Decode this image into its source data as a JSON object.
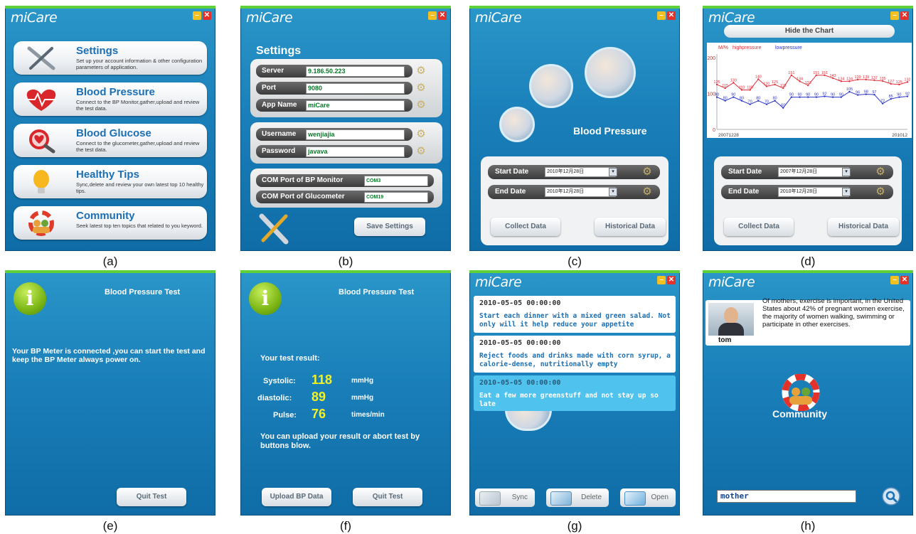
{
  "app_name": "miCare",
  "window_controls": {
    "minimize": "–",
    "close": "✕"
  },
  "captions": [
    "(a)",
    "(b)",
    "(c)",
    "(d)",
    "(e)",
    "(f)",
    "(g)",
    "(h)"
  ],
  "panel_a": {
    "menu": [
      {
        "title": "Settings",
        "desc": "Set up your account information & other configuration parameters of application.",
        "icon": "wrench-screwdriver-icon"
      },
      {
        "title": "Blood Pressure",
        "desc": "Connect to the BP Monitor,gather,upload and review the test data.",
        "icon": "heart-pulse-icon"
      },
      {
        "title": "Blood Glucose",
        "desc": "Connect to the glucometer,gather,upload and review the test data.",
        "icon": "magnifier-heart-icon"
      },
      {
        "title": "Healthy Tips",
        "desc": "Sync,delete and review your own latest top 10 healthy tips.",
        "icon": "light-bulb-icon"
      },
      {
        "title": "Community",
        "desc": "Seek latest top ten topics that related to you keyword.",
        "icon": "lifebuoy-people-icon"
      }
    ]
  },
  "panel_b": {
    "title": "Settings",
    "server": {
      "label": "Server",
      "value": "9.186.50.223"
    },
    "port": {
      "label": "Port",
      "value": "9080"
    },
    "app_name": {
      "label": "App Name",
      "value": "miCare"
    },
    "username": {
      "label": "Username",
      "value": "wenjiajia"
    },
    "password": {
      "label": "Password",
      "value": "javava"
    },
    "com_bp": {
      "label": "COM Port of BP  Monitor",
      "value": "COM3"
    },
    "com_glucometer": {
      "label": "COM Port of Glucometer",
      "value": "COM19"
    },
    "save_button": "Save Settings"
  },
  "panel_c": {
    "title": "Blood Pressure",
    "start_date": {
      "label": "Start Date",
      "value": "2010年12月28日"
    },
    "end_date": {
      "label": "End Date",
      "value": "2010年12月28日"
    },
    "collect_button": "Collect Data",
    "historical_button": "Historical Data"
  },
  "panel_d": {
    "hide_button": "Hide the Chart",
    "start_date": {
      "label": "Start Date",
      "value": "2007年12月28日"
    },
    "end_date": {
      "label": "End Date",
      "value": "2010年12月28日"
    },
    "collect_button": "Collect Data",
    "historical_button": "Historical Data",
    "chart_data": {
      "type": "line",
      "legend_title": "M/%",
      "series": [
        {
          "name": "highpressure",
          "color": "#e0303a",
          "values": [
            125,
            115,
            130,
            110,
            110,
            140,
            120,
            125,
            115,
            151,
            134,
            123,
            151,
            151,
            143,
            134,
            134,
            139,
            139,
            137,
            135,
            127,
            125,
            132
          ]
        },
        {
          "name": "lowpressure",
          "color": "#2c35c8",
          "values": [
            90,
            80,
            90,
            80,
            70,
            80,
            70,
            80,
            60,
            90,
            90,
            90,
            90,
            92,
            90,
            90,
            105,
            96,
            98,
            97,
            72,
            85,
            90,
            92
          ]
        }
      ],
      "y_ticks": [
        "0",
        "100",
        "200"
      ],
      "ylim": [
        0,
        210
      ],
      "x_start_label": "20071228",
      "x_end_label": "201012"
    }
  },
  "panel_e": {
    "title": "Blood Pressure Test",
    "message": "Your BP Meter is connected ,you can start the test and keep the BP Meter always power on.",
    "quit_button": "Quit Test"
  },
  "panel_f": {
    "title": "Blood Pressure Test",
    "result_heading": "Your test result:",
    "systolic": {
      "label": "Systolic:",
      "value": "118",
      "unit": "mmHg"
    },
    "diastolic": {
      "label": "diastolic:",
      "value": "89",
      "unit": "mmHg"
    },
    "pulse": {
      "label": "Pulse:",
      "value": "76",
      "unit": "times/min"
    },
    "note": "You can upload your result or abort test by buttons blow.",
    "upload_button": "Upload BP Data",
    "quit_button": "Quit Test"
  },
  "panel_g": {
    "tips": [
      {
        "time": "2010-05-05 00:00:00",
        "text": "Start each dinner with a mixed green salad. Not only will it help reduce your appetite"
      },
      {
        "time": "2010-05-05 00:00:00",
        "text": "Reject foods and drinks made with corn syrup, a calorie-dense, nutritionally empty"
      },
      {
        "time": "2010-05-05 00:00:00",
        "text": "Eat a few more greenstuff and not stay up so late"
      }
    ],
    "sync_button": "Sync",
    "delete_button": "Delete",
    "open_button": "Open"
  },
  "panel_h": {
    "user_name": "tom",
    "post": "Of mothers, exercise is important, in the United States about 42% of pregnant women exercise, the majority of women walking, swimming or participate in other exercises.",
    "title": "Community",
    "search_value": "mother"
  }
}
